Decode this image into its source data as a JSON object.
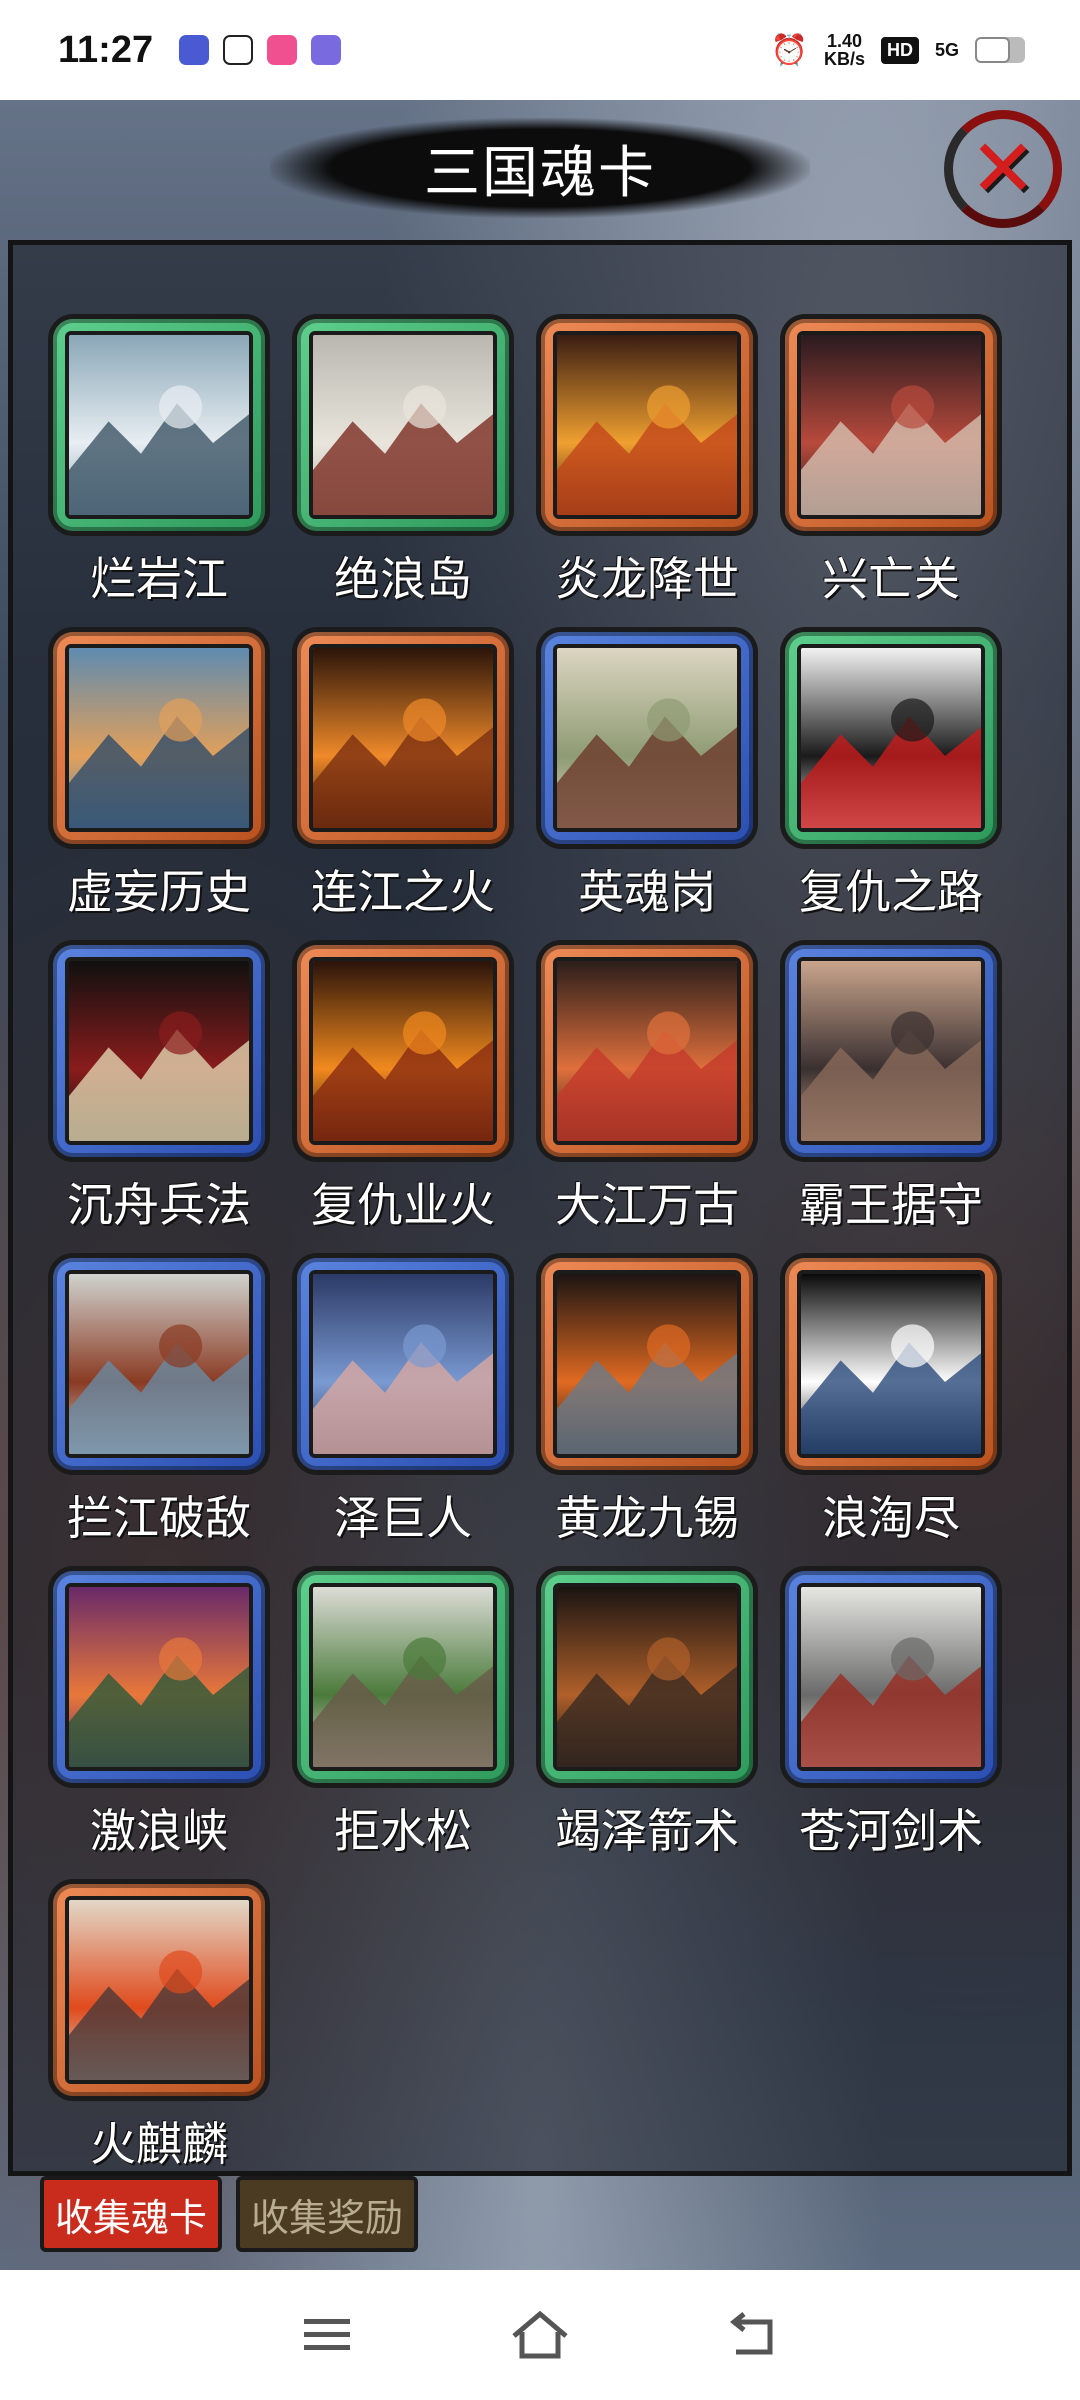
{
  "status_bar": {
    "time": "11:27",
    "net_speed_value": "1.40",
    "net_speed_unit": "KB/s",
    "hd": "HD",
    "signal": "5G",
    "battery_level": 0.7
  },
  "title": "三国魂卡",
  "cards": [
    {
      "name": "烂岩江",
      "frame": "green",
      "colors": [
        "#8aa7b8",
        "#e8eef2",
        "#3d5566"
      ]
    },
    {
      "name": "绝浪岛",
      "frame": "green",
      "colors": [
        "#b9b7b0",
        "#e9e5dc",
        "#7a2c22"
      ]
    },
    {
      "name": "炎龙降世",
      "frame": "orange",
      "colors": [
        "#3a1d12",
        "#f0a030",
        "#c2461a"
      ]
    },
    {
      "name": "兴亡关",
      "frame": "orange",
      "colors": [
        "#2a1a1f",
        "#b84a3c",
        "#d6c0b2"
      ]
    },
    {
      "name": "虚妄历史",
      "frame": "orange",
      "colors": [
        "#5e8bb0",
        "#e2a05a",
        "#2f4c6a"
      ]
    },
    {
      "name": "连江之火",
      "frame": "orange",
      "colors": [
        "#2b1409",
        "#f08a2a",
        "#7a3010"
      ]
    },
    {
      "name": "英魂岗",
      "frame": "blue",
      "colors": [
        "#dcd6c2",
        "#8e9b73",
        "#6c3a2a"
      ]
    },
    {
      "name": "复仇之路",
      "frame": "green",
      "colors": [
        "#f2f2f2",
        "#1a1a1a",
        "#c81c1c"
      ]
    },
    {
      "name": "沉舟兵法",
      "frame": "blue",
      "colors": [
        "#101010",
        "#8a1c1c",
        "#e2d5b0"
      ]
    },
    {
      "name": "复仇业火",
      "frame": "orange",
      "colors": [
        "#2a130a",
        "#f28a1e",
        "#8a2c12"
      ]
    },
    {
      "name": "大江万古",
      "frame": "orange",
      "colors": [
        "#2b1e1a",
        "#e0703c",
        "#c43a2a"
      ]
    },
    {
      "name": "霸王据守",
      "frame": "blue",
      "colors": [
        "#c9a48c",
        "#3a3030",
        "#8a6a5a"
      ]
    },
    {
      "name": "拦江破敌",
      "frame": "blue",
      "colors": [
        "#cfd2cf",
        "#8a3a22",
        "#6a8aa2"
      ]
    },
    {
      "name": "泽巨人",
      "frame": "blue",
      "colors": [
        "#2c3a66",
        "#7a9ad2",
        "#d8a8a0"
      ]
    },
    {
      "name": "黄龙九锡",
      "frame": "orange",
      "colors": [
        "#1c1412",
        "#e06a22",
        "#6a7a8a"
      ]
    },
    {
      "name": "浪淘尽",
      "frame": "orange",
      "colors": [
        "#0a0a0a",
        "#ffffff",
        "#2a4a7a"
      ]
    },
    {
      "name": "激浪峡",
      "frame": "blue",
      "colors": [
        "#6a2a6a",
        "#e8783a",
        "#2a5a3a"
      ]
    },
    {
      "name": "拒水松",
      "frame": "green",
      "colors": [
        "#dcdcd6",
        "#4a7a3a",
        "#6a5a4a"
      ]
    },
    {
      "name": "竭泽箭术",
      "frame": "green",
      "colors": [
        "#1a1412",
        "#b0602a",
        "#3a2a22"
      ]
    },
    {
      "name": "苍河剑术",
      "frame": "blue",
      "colors": [
        "#e6e6e2",
        "#6a6a6a",
        "#9a2a22"
      ]
    },
    {
      "name": "火麒麟",
      "frame": "orange",
      "colors": [
        "#e2d8c8",
        "#e04a1c",
        "#4a3a3a"
      ]
    }
  ],
  "tabs": {
    "active": "收集魂卡",
    "inactive": "收集奖励"
  },
  "accent_colors": {
    "frame_green": "#3fb571",
    "frame_orange": "#d8692f",
    "frame_blue": "#3d66cc",
    "tab_active": "#c92b1c",
    "tab_inactive": "#4a3b22"
  }
}
